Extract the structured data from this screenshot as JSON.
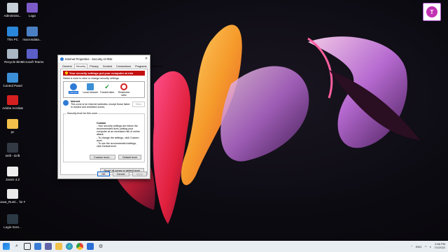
{
  "desktop": {
    "icons": [
      {
        "label": "Administra...",
        "icon": "admin-tools-icon",
        "color": "#c7cfd8"
      },
      {
        "label": "Logo",
        "icon": "folder-icon",
        "color": "#7c5bc9"
      },
      {
        "label": "This PC",
        "icon": "computer-icon",
        "color": "#2a86d8"
      },
      {
        "label": "macrosdata...",
        "icon": "file-icon",
        "color": "#4b7fc4"
      },
      {
        "label": "Recycle Bin",
        "icon": "recycle-bin-icon",
        "color": "#a9b6c4"
      },
      {
        "label": "Microsoft Teams",
        "icon": "teams-icon",
        "color": "#5b5fc7"
      },
      {
        "label": "Control Panel",
        "icon": "control-panel-icon",
        "color": "#3b8fd6"
      },
      {
        "label": "Adobe Acrobat",
        "icon": "acrobat-icon",
        "color": "#d42020"
      },
      {
        "label": "pc",
        "icon": "folder-icon",
        "color": "#f2c14a"
      },
      {
        "label": "Drift - Drift",
        "icon": "app-icon",
        "color": "#333a44"
      },
      {
        "label": "Jaxxis 4.2",
        "icon": "app-icon",
        "color": "#eeeeee"
      },
      {
        "label": "Java_Runti... for PFMS",
        "icon": "java-icon",
        "color": "#e9e9e9"
      },
      {
        "label": "Login-Scre...",
        "icon": "app-icon",
        "color": "#2b3945"
      }
    ]
  },
  "dialog": {
    "title": "Internet Properties - Security At Risk",
    "minimize": "—",
    "maximize": "☐",
    "close": "✕",
    "tabs": [
      "General",
      "Security",
      "Privacy",
      "Content",
      "Connections",
      "Programs",
      "Advanced"
    ],
    "warning": "Your security settings put your computer at risk",
    "select_zone_label": "Select a zone to view or change security settings.",
    "zones": [
      {
        "label": "Internet",
        "icon": "globe-icon",
        "color": "#2e7bd6"
      },
      {
        "label": "Local intranet",
        "icon": "intranet-icon",
        "color": "#3b8fd6"
      },
      {
        "label": "Trusted sites",
        "icon": "checkmark-icon",
        "color": "#2ea043"
      },
      {
        "label": "Restricted sites",
        "icon": "no-entry-icon",
        "color": "#d42020"
      }
    ],
    "zone_title": "Internet",
    "zone_desc": "This zone is for Internet websites, except those listed in trusted and restricted zones.",
    "sites_button": "Sites",
    "level_legend": "Security level for this zone",
    "custom_title": "Custom",
    "custom_lines": [
      "- Your security settings are below the recommended level, putting your computer at an increased risk of online attack.",
      "- To change the settings, click Custom level.",
      "- To use the recommended settings, click Default level."
    ],
    "custom_level_button": "Custom level...",
    "default_level_button": "Default level",
    "reset_button": "Reset all zones to default level",
    "ok_button": "OK",
    "cancel_button": "Cancel",
    "apply_button": "Apply"
  },
  "taskbar": {
    "language": "ENG",
    "time": "2:58 PM",
    "date": "7/1/2022"
  }
}
